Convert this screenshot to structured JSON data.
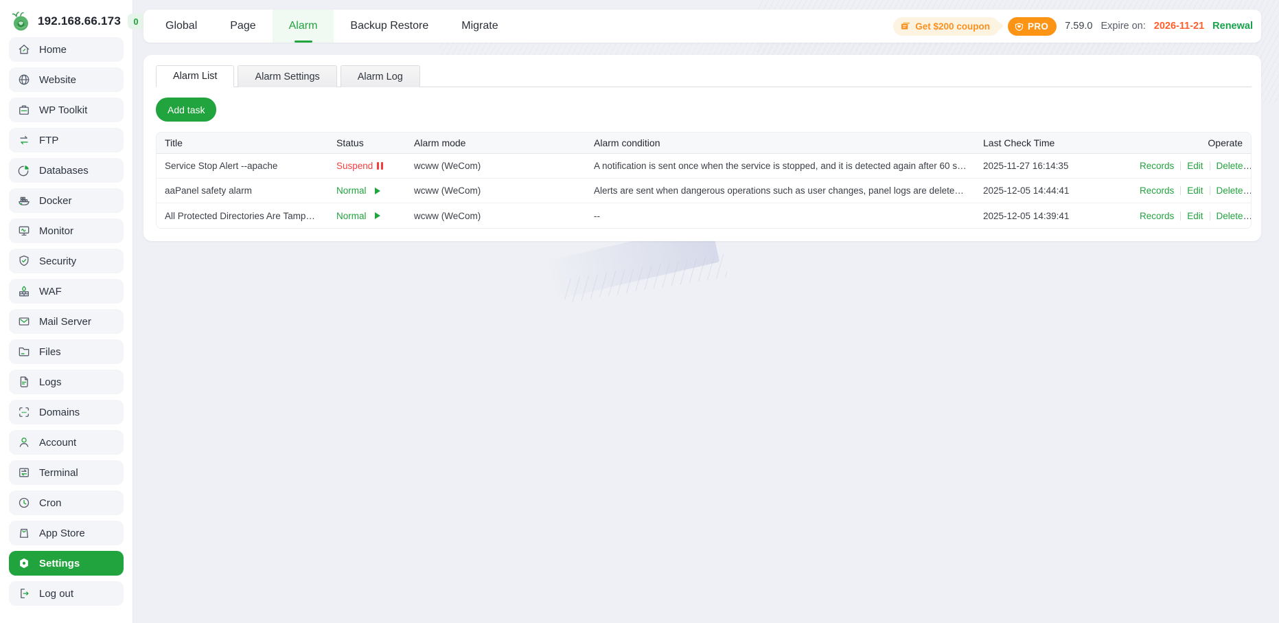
{
  "colors": {
    "accent_green": "#21a33e",
    "orange": "#fb9021",
    "expire_red": "#ff5e2c",
    "suspend_red": "#f23d3d",
    "background": "#eef0f5"
  },
  "app": {
    "server_ip": "192.168.66.173",
    "badge_count": "0"
  },
  "sidebar": {
    "items": [
      {
        "label": "Home"
      },
      {
        "label": "Website"
      },
      {
        "label": "WP Toolkit"
      },
      {
        "label": "FTP"
      },
      {
        "label": "Databases"
      },
      {
        "label": "Docker"
      },
      {
        "label": "Monitor"
      },
      {
        "label": "Security"
      },
      {
        "label": "WAF"
      },
      {
        "label": "Mail Server"
      },
      {
        "label": "Files"
      },
      {
        "label": "Logs"
      },
      {
        "label": "Domains"
      },
      {
        "label": "Account"
      },
      {
        "label": "Terminal"
      },
      {
        "label": "Cron"
      },
      {
        "label": "App Store"
      },
      {
        "label": "Settings",
        "active": true
      },
      {
        "label": "Log out"
      }
    ]
  },
  "topnav": {
    "items": [
      {
        "label": "Global"
      },
      {
        "label": "Page"
      },
      {
        "label": "Alarm",
        "active": true
      },
      {
        "label": "Backup Restore"
      },
      {
        "label": "Migrate"
      }
    ]
  },
  "header_right": {
    "coupon_label": "Get $200 coupon",
    "pro_label": "PRO",
    "version": "7.59.0",
    "expire_label": "Expire on:",
    "expire_date": "2026-11-21",
    "renewal_label": "Renewal"
  },
  "tabs": [
    {
      "label": "Alarm List",
      "active": true
    },
    {
      "label": "Alarm Settings"
    },
    {
      "label": "Alarm Log"
    }
  ],
  "toolbar": {
    "add_task_label": "Add task"
  },
  "table": {
    "columns": [
      "Title",
      "Status",
      "Alarm mode",
      "Alarm condition",
      "Last Check Time",
      "Operate"
    ],
    "ops": {
      "records": "Records",
      "edit": "Edit",
      "delete": "Delete"
    },
    "rows": [
      {
        "title": "Service Stop Alert --apache",
        "status": {
          "label": "Suspend",
          "state": "suspend"
        },
        "mode": "wcww (WeCom)",
        "condition": "A notification is sent once when the service is stopped, and it is detected again after 60 se...",
        "last_check": "2025-11-27 16:14:35"
      },
      {
        "title": "aaPanel safety alarm",
        "status": {
          "label": "Normal",
          "state": "normal"
        },
        "mode": "wcww (WeCom)",
        "condition": "Alerts are sent when dangerous operations such as user changes, panel logs are deleted, a...",
        "last_check": "2025-12-05 14:44:41"
      },
      {
        "title": "All Protected Directories Are Tamper-Proof – ...",
        "status": {
          "label": "Normal",
          "state": "normal"
        },
        "mode": "wcww (WeCom)",
        "condition": "--",
        "last_check": "2025-12-05 14:39:41"
      }
    ]
  }
}
